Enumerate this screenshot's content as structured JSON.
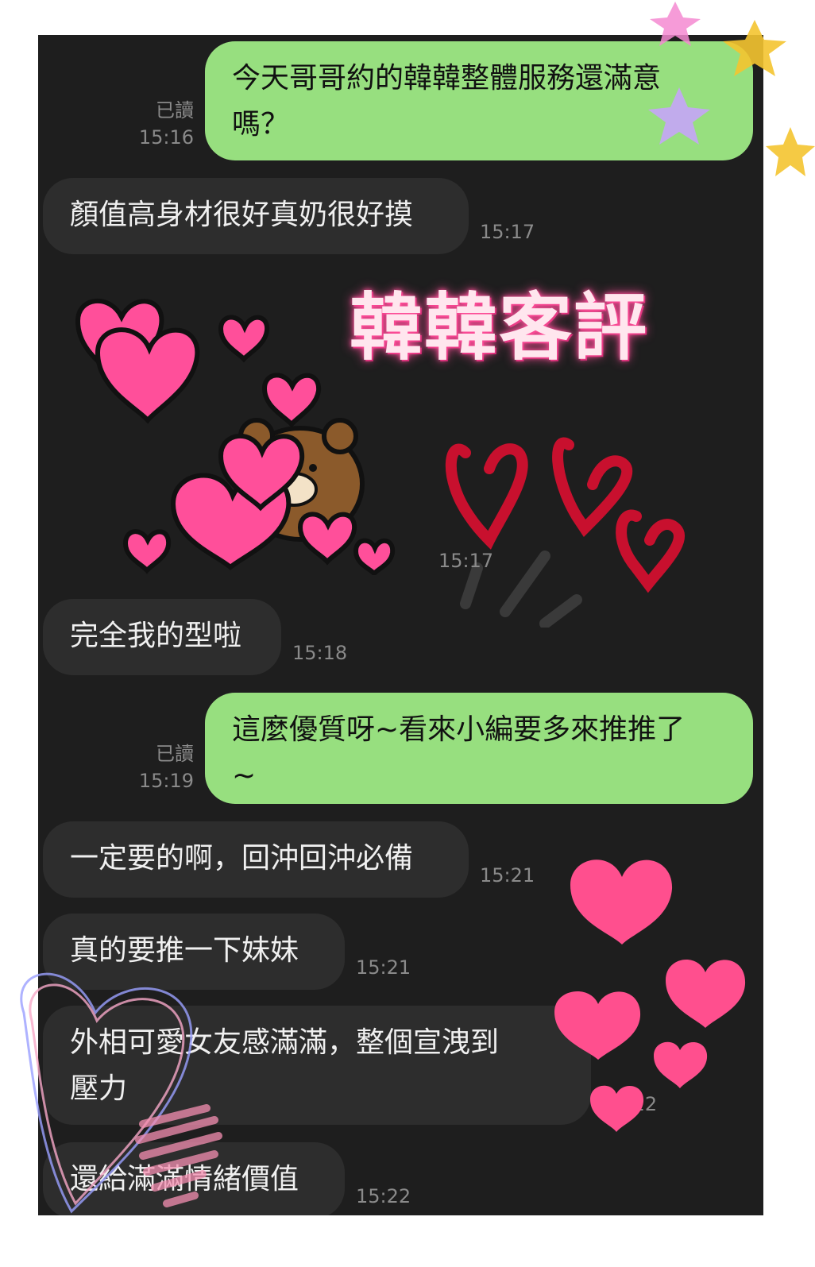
{
  "messages": [
    {
      "side": "sent",
      "text_line1": "今天哥哥約的韓韓整體服務還滿意",
      "text_line2": "嗎？",
      "read": "已讀",
      "time": "15:16"
    },
    {
      "side": "recv",
      "text": "顏值高身材很好真奶很好摸",
      "time": "15:17"
    },
    {
      "side": "sticker",
      "time": "15:17"
    },
    {
      "side": "recv",
      "text": "完全我的型啦",
      "time": "15:18"
    },
    {
      "side": "sent",
      "text_line1": "這麼優質呀~看來小編要多來推推了",
      "text_line2": "~",
      "read": "已讀",
      "time": "15:19"
    },
    {
      "side": "recv",
      "text": "一定要的啊，回沖回沖必備",
      "time": "15:21"
    },
    {
      "side": "recv",
      "text": "真的要推一下妹妹",
      "time": "15:21"
    },
    {
      "side": "recv",
      "text_line1": "外相可愛女友感滿滿，整個宣洩到",
      "text_line2": "壓力",
      "time": "15:22"
    },
    {
      "side": "recv",
      "text": "還給滿滿情緒價值",
      "time": "15:22"
    }
  ],
  "overlay_title": "韓韓客評",
  "colors": {
    "sent_bubble": "#97df7f",
    "recv_bubble": "#2d2d2d",
    "chat_bg": "#1e1e1e",
    "heart_pink": "#ff4f8e",
    "heart_red": "#c8102e"
  }
}
